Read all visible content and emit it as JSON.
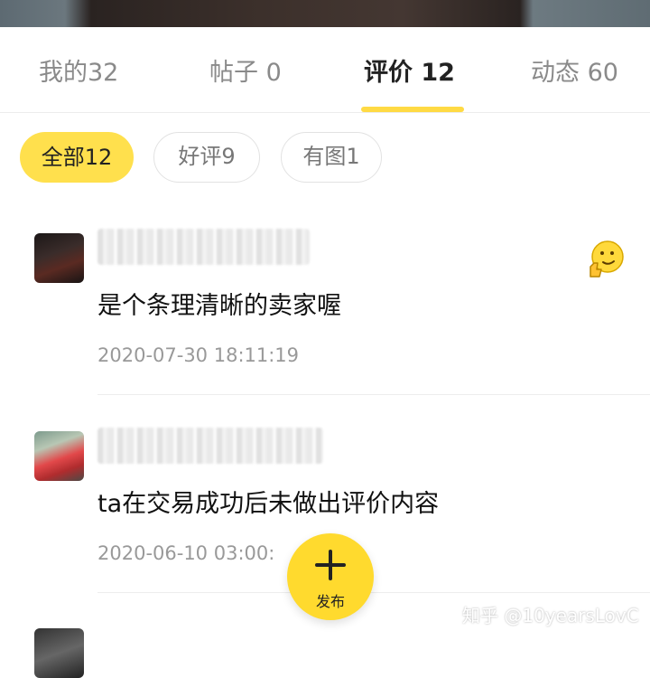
{
  "tabs": [
    {
      "label": "我的32",
      "active": false
    },
    {
      "label": "帖子 0",
      "active": false
    },
    {
      "label": "评价 12",
      "active": true
    },
    {
      "label": "动态 60",
      "active": false
    }
  ],
  "filters": [
    {
      "label": "全部12",
      "active": true
    },
    {
      "label": "好评9",
      "active": false
    },
    {
      "label": "有图1",
      "active": false
    }
  ],
  "reviews": [
    {
      "text": "是个条理清晰的卖家喔",
      "time": "2020-07-30 18:11:19",
      "reaction_icon": "thumbs-up-face-icon"
    },
    {
      "text": "ta在交易成功后未做出评价内容",
      "time": "2020-06-10 03:00:"
    }
  ],
  "publish": {
    "label": "发布",
    "icon": "plus-icon"
  },
  "watermark": "知乎 @10yearsLovC",
  "colors": {
    "accent": "#ffda44",
    "active_chip": "#ffe04d"
  }
}
